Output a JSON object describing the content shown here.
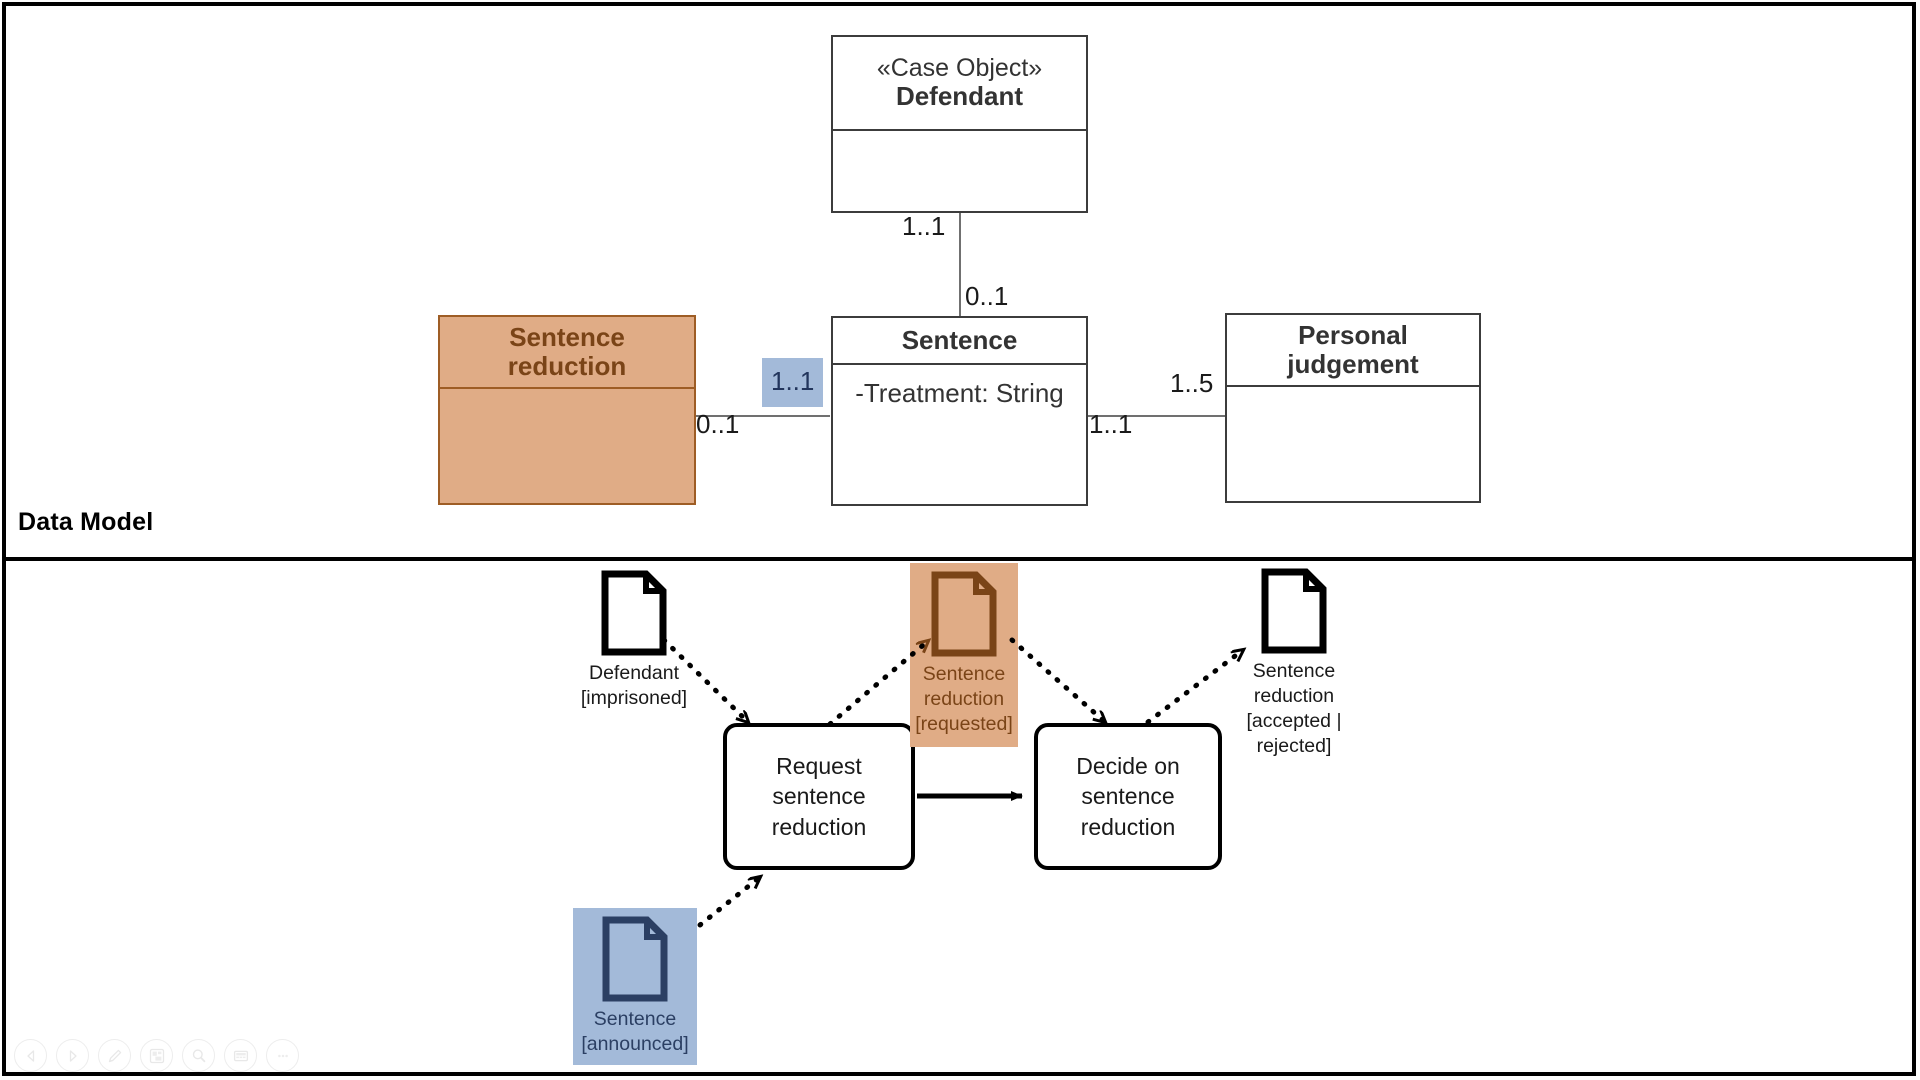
{
  "sections": {
    "data_model_label": "Data Model"
  },
  "data_model": {
    "classes": [
      {
        "id": "defendant",
        "stereotype": "«Case Object»",
        "name": "Defendant",
        "attributes": "",
        "highlight": "none"
      },
      {
        "id": "sentence_reduction",
        "stereotype": "",
        "name": "Sentence reduction",
        "name_line1": "Sentence",
        "name_line2": "reduction",
        "attributes": "",
        "highlight": "orange"
      },
      {
        "id": "sentence",
        "stereotype": "",
        "name": "Sentence",
        "attributes": "-Treatment: String",
        "highlight": "none"
      },
      {
        "id": "personal_judgement",
        "stereotype": "",
        "name": "Personal judgement",
        "name_line1": "Personal",
        "name_line2": "judgement",
        "attributes": "",
        "highlight": "none"
      }
    ],
    "multiplicities": [
      {
        "id": "defendant_end",
        "value": "1..1",
        "highlight": "none"
      },
      {
        "id": "sentence_top_end",
        "value": "0..1",
        "highlight": "none"
      },
      {
        "id": "sentence_left_end",
        "value": "1..1",
        "highlight": "blue"
      },
      {
        "id": "reduction_right_end",
        "value": "0..1",
        "highlight": "none"
      },
      {
        "id": "judgement_left_end",
        "value": "1..5",
        "highlight": "none"
      },
      {
        "id": "sentence_right_end",
        "value": "1..1",
        "highlight": "none"
      }
    ]
  },
  "process_model": {
    "tasks": [
      {
        "id": "request",
        "label": "Request sentence reduction"
      },
      {
        "id": "decide",
        "label": "Decide on sentence reduction"
      }
    ],
    "data_objects": [
      {
        "id": "defendant_imprisoned",
        "label": "Defendant\n[imprisoned]",
        "highlight": "none"
      },
      {
        "id": "reduction_requested",
        "label": "Sentence\nreduction\n[requested]",
        "highlight": "orange"
      },
      {
        "id": "reduction_decided",
        "label": "Sentence\nreduction\n[accepted |\nrejected]",
        "highlight": "none"
      },
      {
        "id": "sentence_announced",
        "label": "Sentence\n[announced]",
        "highlight": "blue"
      }
    ]
  },
  "toolbar": {
    "buttons": [
      {
        "id": "back",
        "icon": "back-arrow-icon"
      },
      {
        "id": "forward",
        "icon": "forward-arrow-icon"
      },
      {
        "id": "edit",
        "icon": "pencil-icon"
      },
      {
        "id": "layers",
        "icon": "layers-icon"
      },
      {
        "id": "zoom",
        "icon": "magnifier-icon"
      },
      {
        "id": "view",
        "icon": "card-view-icon"
      },
      {
        "id": "more",
        "icon": "ellipsis-icon"
      }
    ]
  },
  "colors": {
    "highlight_orange": "#e0ac86",
    "highlight_orange_stroke": "#7a4417",
    "highlight_blue": "#a3bad9",
    "highlight_blue_stroke": "#2b3f63",
    "class_stroke": "#3c3c3c",
    "assoc_stroke": "#707070",
    "task_stroke": "#000000"
  }
}
